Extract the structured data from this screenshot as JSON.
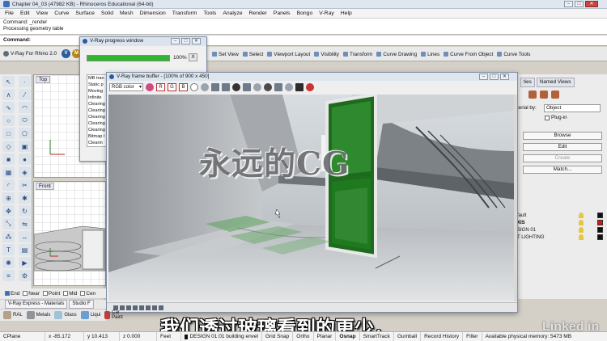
{
  "window": {
    "title": "Chapter 04_03 (47982 KB) - Rhinoceros Educational (64-bit)"
  },
  "menu": [
    "File",
    "Edit",
    "View",
    "Curve",
    "Surface",
    "Solid",
    "Mesh",
    "Dimension",
    "Transform",
    "Tools",
    "Analyze",
    "Render",
    "Panels",
    "Bongo",
    "V-Ray",
    "Help"
  ],
  "command_history": [
    "Command: _render",
    "Processing geometry table"
  ],
  "command_prompt": "Command:",
  "toolbar_tabs": {
    "vray_tab": "V-Ray For Rhino 2.0",
    "vray_buttons": [
      "V",
      "M",
      "R",
      "O"
    ],
    "items": [
      "Set View",
      "Select",
      "Viewport Layout",
      "Visibility",
      "Transform",
      "Curve Drawing",
      "Lines",
      "Curve From Object",
      "Curve Tools"
    ]
  },
  "viewports": {
    "top_label": "Top",
    "front_label": "Front"
  },
  "progress_window": {
    "title": "V-Ray progress window",
    "percent": "100%",
    "progress_fraction": 1.0,
    "close_label": "X",
    "log_lines": [
      "MB tran",
      "Static p",
      "Moving",
      "Infinite",
      "Clearing",
      "Clearing",
      "Clearing",
      "Clearing",
      "Clearing",
      "Bitmap I",
      "Clearin"
    ]
  },
  "frame_buffer": {
    "title": "V-Ray frame buffer - [100% of 900 x 450]",
    "channel": "RGB color",
    "channels": [
      "R",
      "G",
      "B"
    ]
  },
  "watermark": "永远的CG",
  "right_panel": {
    "tabs": [
      "ties",
      "Named Views"
    ],
    "material_label": "terial by:",
    "material_value": "Object",
    "plugin_label": "Plug-in",
    "buttons": [
      "Browse",
      "Edit",
      "Create",
      "Match..."
    ],
    "layers": [
      {
        "name": "fault",
        "color": "#111111"
      },
      {
        "name": "XIS",
        "color": "#cc1a1a"
      },
      {
        "name": "SIGN 01",
        "color": "#111111"
      },
      {
        "name": "T LIGHTING",
        "color": "#111111"
      }
    ]
  },
  "osnap": {
    "items": [
      {
        "label": "End",
        "checked": true
      },
      {
        "label": "Near",
        "checked": false
      },
      {
        "label": "Point",
        "checked": false
      },
      {
        "label": "Mid",
        "checked": false
      },
      {
        "label": "Cen",
        "checked": false
      }
    ]
  },
  "materials_tabs": [
    "V-Ray Express - Materials",
    "Studio F"
  ],
  "materials": [
    "RAL",
    "Metals",
    "Glass",
    "Liqui",
    "Car Paint"
  ],
  "subtitle": "我们透过玻璃看到的更少，",
  "brand": "Linked in",
  "statusbar": {
    "plane": "CPlane",
    "x": "x -85.172",
    "y": "y 10.413",
    "z": "z 0.000",
    "units": "Feet",
    "layer": "DESIGN 01:01 building envel",
    "items": [
      "Grid Snap",
      "Ortho",
      "Planar",
      "Osnap",
      "SmartTrack",
      "Gumball",
      "Record History",
      "Filter"
    ],
    "memory": "Available physical memory: 5473 MB"
  }
}
